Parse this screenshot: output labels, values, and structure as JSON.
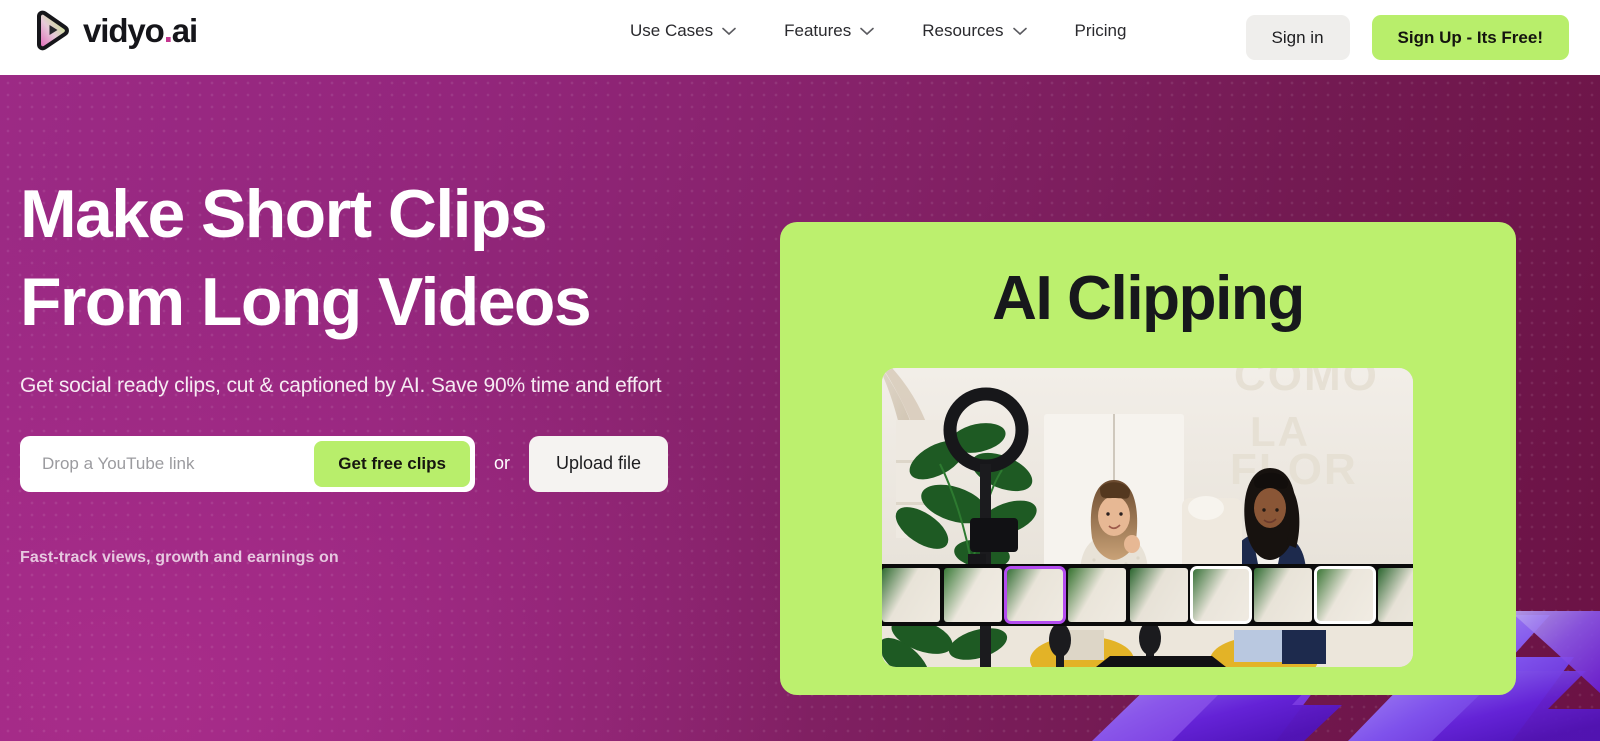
{
  "brand": {
    "name_main": "vidyo",
    "name_dot": ".",
    "name_suffix": "ai",
    "logo_icon": "play-triangle-gradient-icon"
  },
  "header": {
    "nav": [
      {
        "label": "Use Cases",
        "has_dropdown": true,
        "icon": "chevron-down-icon"
      },
      {
        "label": "Features",
        "has_dropdown": true,
        "icon": "chevron-down-icon"
      },
      {
        "label": "Resources",
        "has_dropdown": true,
        "icon": "chevron-down-icon"
      },
      {
        "label": "Pricing",
        "has_dropdown": false
      }
    ],
    "sign_in_label": "Sign in",
    "sign_up_label": "Sign Up - Its Free!"
  },
  "hero": {
    "headline_line1": "Make Short Clips",
    "headline_line2": "From Long Videos",
    "subtitle": "Get social ready clips, cut & captioned by AI. Save 90% time and effort",
    "input_placeholder": "Drop a YouTube link",
    "input_value": "",
    "get_clips_label": "Get free clips",
    "or_label": "or",
    "upload_label": "Upload file",
    "fast_track_label": "Fast-track views, growth and earnings on"
  },
  "card": {
    "title": "AI Clipping",
    "video_alt": "podcast-studio-two-women-interview",
    "wall_text_line1": "COMO",
    "wall_text_line2": "LA",
    "wall_text_line3": "FLOR",
    "timeline": {
      "frames": 9,
      "selected_index": 2,
      "selected_color": "#b44cf0",
      "marked_indices": [
        5,
        7
      ],
      "marked_color": "#ffffff"
    }
  },
  "decor": {
    "shapes_icon": "purple-3d-chevron-shapes",
    "dot_pattern": "dot-grid-overlay"
  },
  "colors": {
    "brand_green": "#bcf06e",
    "brand_magenta": "#9f2a84",
    "brand_plum": "#6b1244",
    "accent_purple": "#b44cf0",
    "logo_dot": "#c4368f"
  }
}
